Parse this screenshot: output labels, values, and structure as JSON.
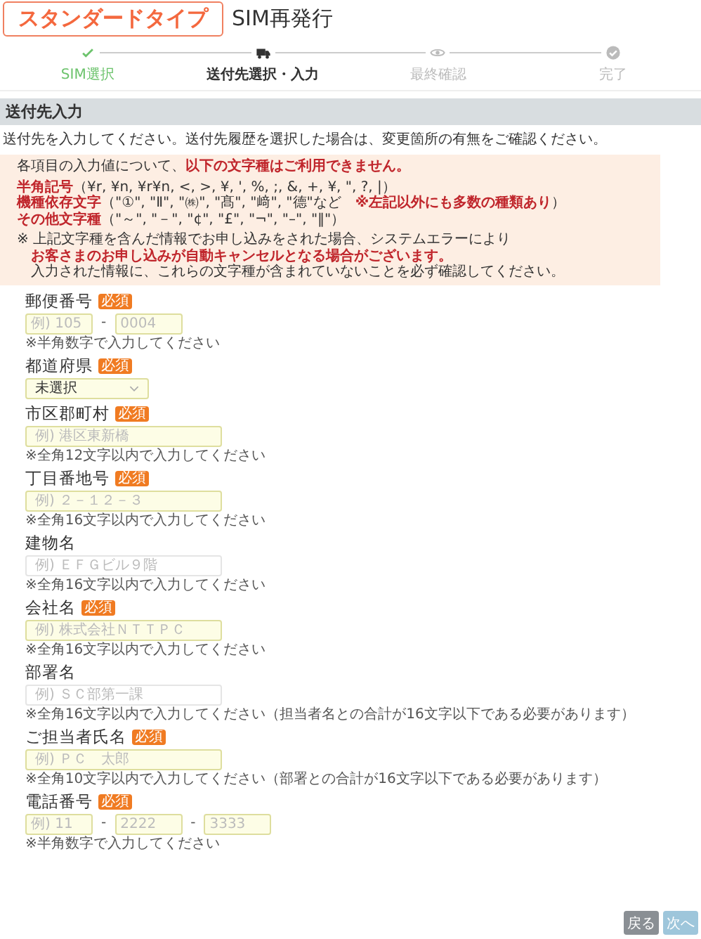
{
  "header": {
    "badge": "スタンダードタイプ",
    "title": "SIM再発行"
  },
  "steps": [
    {
      "label": "SIM選択",
      "done": true,
      "selected": false
    },
    {
      "label": "送付先選択・入力",
      "done": false,
      "selected": true
    },
    {
      "label": "最終確認",
      "done": false,
      "selected": false
    },
    {
      "label": "完了",
      "done": false,
      "selected": false
    }
  ],
  "section": {
    "title": "送付先入力",
    "intro": "送付先を入力してください。送付先履歴を選択した場合は、変更箇所の有無をご確認ください。"
  },
  "notice": {
    "lead": "各項目の入力値について、**以下の文字種はご利用できません。**",
    "rules": [
      {
        "label": "半角記号",
        "text": "（¥r, ¥n, ¥r¥n, <, >, ¥, ', %, ;, &, +, ¥, \", ?, |）"
      },
      {
        "label": "機種依存文字",
        "text": "（\"①\", \"Ⅱ\", \"㈱\", \"髙\", \"﨑\", \"德\"など　**※左記以外にも多数の種類あり**）"
      },
      {
        "label": "その他文字種",
        "text": "（\"～\", \"－\", \"¢\", \"£\", \"¬\", \"–\", \"‖\"）"
      }
    ],
    "notes": [
      "※ 上記文字種を含んだ情報でお申し込みをされた場合、システムエラーにより",
      "**お客さまのお申し込みが自動キャンセルとなる場合がございます。**",
      "入力された情報に、これらの文字種が含まれていないことを必ず確認してください。"
    ]
  },
  "fields": [
    {
      "kind": "split",
      "label": "郵便番号",
      "required": true,
      "badge": "必須",
      "inputs": [
        {
          "placeholder": "例) 105"
        },
        {
          "separator": "-",
          "placeholder": "0004"
        }
      ],
      "help": "※半角数字で入力してください"
    },
    {
      "kind": "select",
      "label": "都道府県",
      "required": true,
      "badge": "必須",
      "value": "未選択"
    },
    {
      "kind": "text",
      "label": "市区郡町村",
      "required": true,
      "badge": "必須",
      "placeholder": "例) 港区東新橋",
      "help": "※全角12文字以内で入力してください"
    },
    {
      "kind": "text",
      "label": "丁目番地号",
      "required": true,
      "badge": "必須",
      "placeholder": "例) ２－１２－３",
      "help": "※全角16文字以内で入力してください"
    },
    {
      "kind": "text",
      "label": "建物名",
      "required": false,
      "placeholder": "例) ＥＦＧビル９階",
      "help": "※全角16文字以内で入力してください"
    },
    {
      "kind": "text",
      "label": "会社名",
      "required": true,
      "badge": "必須",
      "placeholder": "例) 株式会社ＮＴＴＰＣ",
      "help": "※全角16文字以内で入力してください"
    },
    {
      "kind": "text",
      "label": "部署名",
      "required": false,
      "placeholder": "例) ＳＣ部第一課",
      "help": "※全角16文字以内で入力してください（担当者名との合計が16文字以下である必要があります）"
    },
    {
      "kind": "text",
      "label": "ご担当者氏名",
      "required": true,
      "badge": "必須",
      "placeholder": "例) ＰＣ　太郎",
      "help": "※全角10文字以内で入力してください（部署との合計が16文字以下である必要があります）"
    },
    {
      "kind": "split",
      "label": "電話番号",
      "required": true,
      "badge": "必須",
      "inputs": [
        {
          "placeholder": "例) 11"
        },
        {
          "separator": "-",
          "placeholder": "2222"
        },
        {
          "separator": "-",
          "placeholder": "3333"
        }
      ],
      "help": "※半角数字で入力してください"
    }
  ],
  "buttons": [
    {
      "label": "戻る",
      "kind": "back"
    },
    {
      "label": "次へ",
      "kind": "next",
      "disabled": true
    }
  ]
}
